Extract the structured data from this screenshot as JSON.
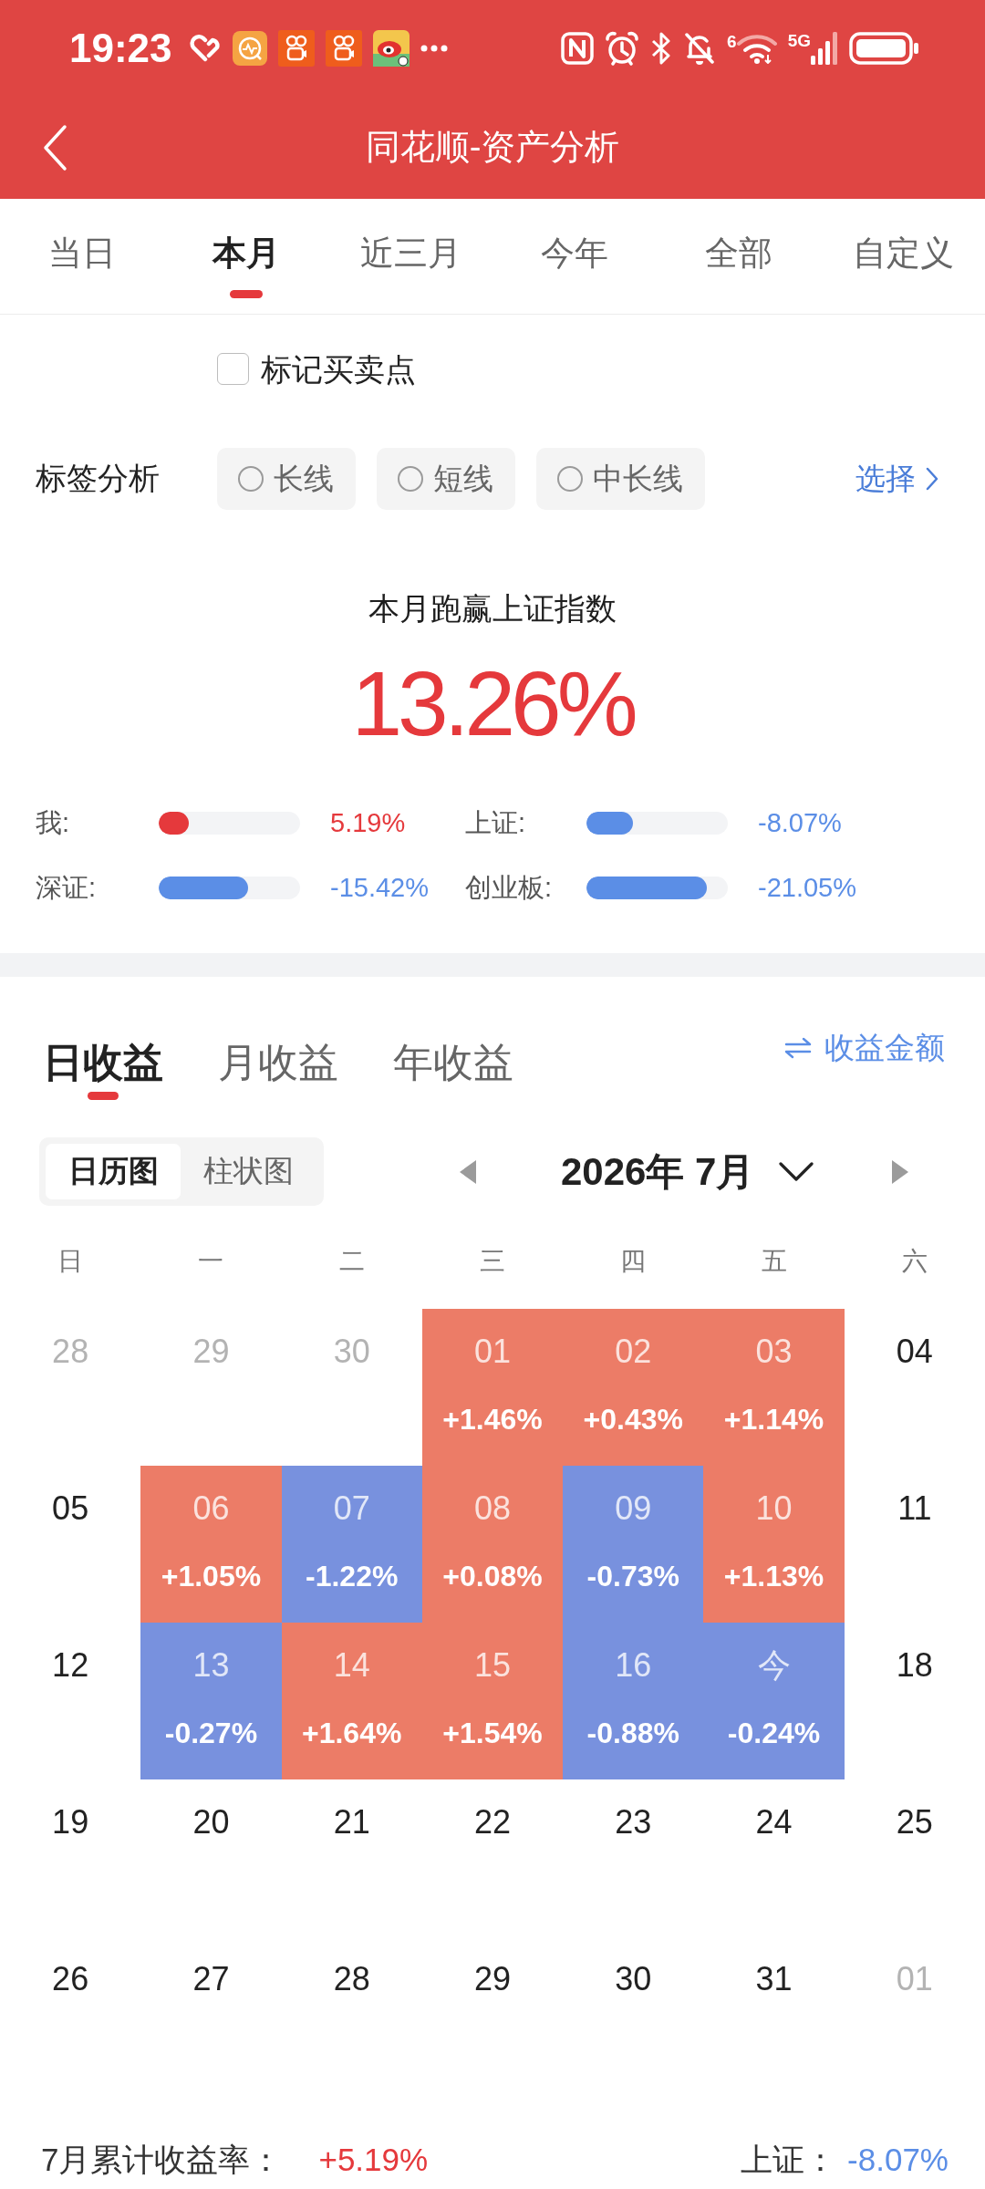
{
  "status_bar": {
    "time": "19:23",
    "wifi_label": "6",
    "network_label": "5G"
  },
  "header": {
    "title": "同花顺-资产分析"
  },
  "period_tabs": [
    {
      "label": "当日",
      "selected": false
    },
    {
      "label": "本月",
      "selected": true
    },
    {
      "label": "近三月",
      "selected": false
    },
    {
      "label": "今年",
      "selected": false
    },
    {
      "label": "全部",
      "selected": false
    },
    {
      "label": "自定义",
      "selected": false
    }
  ],
  "options": [
    {
      "label": "标记买卖点",
      "checked": false
    }
  ],
  "tag_filter": {
    "label": "标签分析",
    "chips": [
      {
        "label": "长线",
        "selected": false
      },
      {
        "label": "短线",
        "selected": false
      },
      {
        "label": "中长线",
        "selected": false
      }
    ],
    "action": "选择"
  },
  "summary": {
    "title": "本月跑赢上证指数",
    "value": "13.26%",
    "comparisons": [
      {
        "label": "我:",
        "level": 0.21,
        "value": "5.19%",
        "color": "#e5393c"
      },
      {
        "label": "上证:",
        "level": 0.33,
        "value": "-8.07%",
        "color": "#5b8ee6"
      },
      {
        "label": "深证:",
        "level": 0.63,
        "value": "-15.42%",
        "color": "#5b8ee6"
      },
      {
        "label": "创业板:",
        "level": 0.85,
        "value": "-21.05%",
        "color": "#5b8ee6"
      }
    ]
  },
  "returns": {
    "tabs": [
      {
        "label": "日收益",
        "selected": true
      },
      {
        "label": "月收益",
        "selected": false
      },
      {
        "label": "年收益",
        "selected": false
      }
    ],
    "switch_label": "收益金额",
    "view_modes": [
      {
        "label": "日历图",
        "selected": true
      },
      {
        "label": "柱状图",
        "selected": false
      }
    ],
    "month": "2026年 7月",
    "weekdays": [
      "日",
      "一",
      "二",
      "三",
      "四",
      "五",
      "六"
    ],
    "weeks": [
      {
        "days": [
          {
            "day": "28",
            "muted": true
          },
          {
            "day": "29",
            "muted": true
          },
          {
            "day": "30",
            "muted": true
          },
          {
            "day": "01",
            "muted": false,
            "change": "+1.46%",
            "color": "#ec7c67"
          },
          {
            "day": "02",
            "muted": false,
            "change": "+0.43%",
            "color": "#ec7c67"
          },
          {
            "day": "03",
            "muted": false,
            "change": "+1.14%",
            "color": "#ec7c67"
          },
          {
            "day": "04",
            "muted": false
          }
        ]
      },
      {
        "days": [
          {
            "day": "05",
            "muted": false
          },
          {
            "day": "06",
            "muted": false,
            "change": "+1.05%",
            "color": "#ec7c67"
          },
          {
            "day": "07",
            "muted": false,
            "change": "-1.22%",
            "color": "#7891de"
          },
          {
            "day": "08",
            "muted": false,
            "change": "+0.08%",
            "color": "#ec7c67"
          },
          {
            "day": "09",
            "muted": false,
            "change": "-0.73%",
            "color": "#7891de"
          },
          {
            "day": "10",
            "muted": false,
            "change": "+1.13%",
            "color": "#ec7c67"
          },
          {
            "day": "11",
            "muted": false
          }
        ]
      },
      {
        "days": [
          {
            "day": "12",
            "muted": false
          },
          {
            "day": "13",
            "muted": false,
            "change": "-0.27%",
            "color": "#7891de"
          },
          {
            "day": "14",
            "muted": false,
            "change": "+1.64%",
            "color": "#ec7c67"
          },
          {
            "day": "15",
            "muted": false,
            "change": "+1.54%",
            "color": "#ec7c67"
          },
          {
            "day": "16",
            "muted": false,
            "change": "-0.88%",
            "color": "#7891de"
          },
          {
            "day": "今",
            "muted": false,
            "change": "-0.24%",
            "color": "#7891de"
          },
          {
            "day": "18",
            "muted": false
          }
        ]
      },
      {
        "days": [
          {
            "day": "19",
            "muted": false
          },
          {
            "day": "20",
            "muted": false
          },
          {
            "day": "21",
            "muted": false
          },
          {
            "day": "22",
            "muted": false
          },
          {
            "day": "23",
            "muted": false
          },
          {
            "day": "24",
            "muted": false
          },
          {
            "day": "25",
            "muted": false
          }
        ]
      },
      {
        "days": [
          {
            "day": "26",
            "muted": false
          },
          {
            "day": "27",
            "muted": false
          },
          {
            "day": "28",
            "muted": false
          },
          {
            "day": "29",
            "muted": false
          },
          {
            "day": "30",
            "muted": false
          },
          {
            "day": "31",
            "muted": false
          },
          {
            "day": "01",
            "muted": true
          }
        ]
      }
    ]
  },
  "footer": [
    {
      "label": "7月累计收益率：",
      "value": "+5.19%",
      "color": "#e5393c"
    },
    {
      "label": "上证：",
      "value": "-8.07%",
      "color": "#5b8ee6"
    }
  ]
}
